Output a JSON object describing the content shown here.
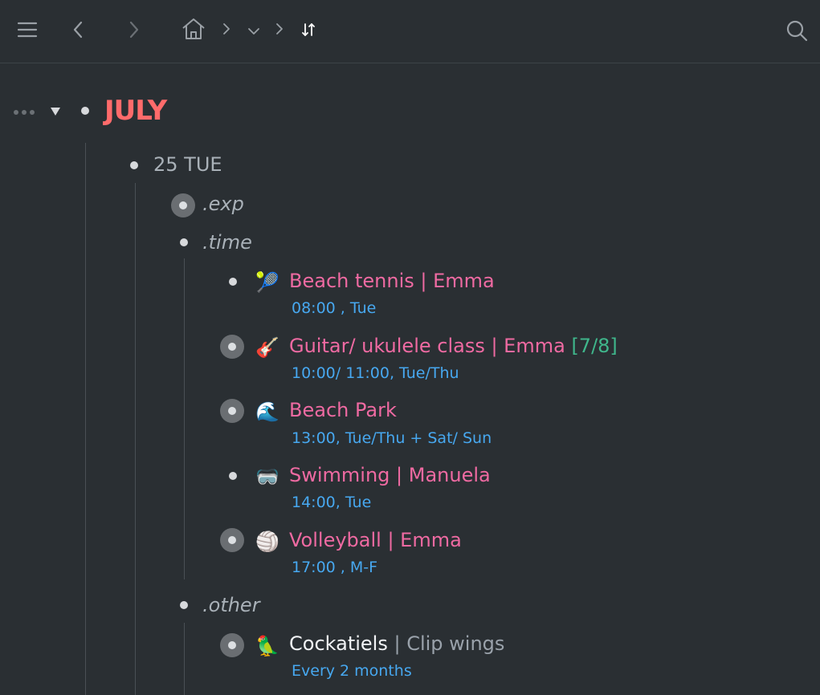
{
  "toolbar": {
    "menu_icon": "hamburger-icon",
    "back_icon": "chevron-left-icon",
    "forward_icon": "chevron-right-icon",
    "home_icon": "home-icon",
    "sort_icon": "sort-arrows-icon",
    "search_icon": "search-icon"
  },
  "root": {
    "title": "JULY"
  },
  "day": {
    "label": "25 TUE"
  },
  "tags": {
    "exp": ".exp",
    "time": ".time",
    "other": ".other"
  },
  "items": [
    {
      "emoji": "🎾",
      "title": "Beach tennis | Emma",
      "meta": "08:00 , Tue"
    },
    {
      "emoji": "🎸",
      "title": "Guitar/ ukulele class | Emma ",
      "count": "[7/8]",
      "meta": "10:00/ 11:00, Tue/Thu"
    },
    {
      "emoji": "🌊",
      "title": "Beach Park",
      "meta": "13:00, Tue/Thu + Sat/ Sun"
    },
    {
      "emoji": "🥽",
      "title": "Swimming | Manuela",
      "meta": "14:00, Tue"
    },
    {
      "emoji": "🏐",
      "title": "Volleyball | Emma",
      "meta": "17:00 , M-F"
    }
  ],
  "other_items": [
    {
      "emoji": "🦜",
      "title": "Cockatiels",
      "separator": " | ",
      "subtitle": "Clip wings",
      "meta": "Every 2 months"
    }
  ],
  "colors": {
    "background": "#2a2f33",
    "root_title": "#ff6b6b",
    "item_title": "#ef6aa2",
    "meta": "#47a8f0",
    "count": "#3fb68b"
  }
}
